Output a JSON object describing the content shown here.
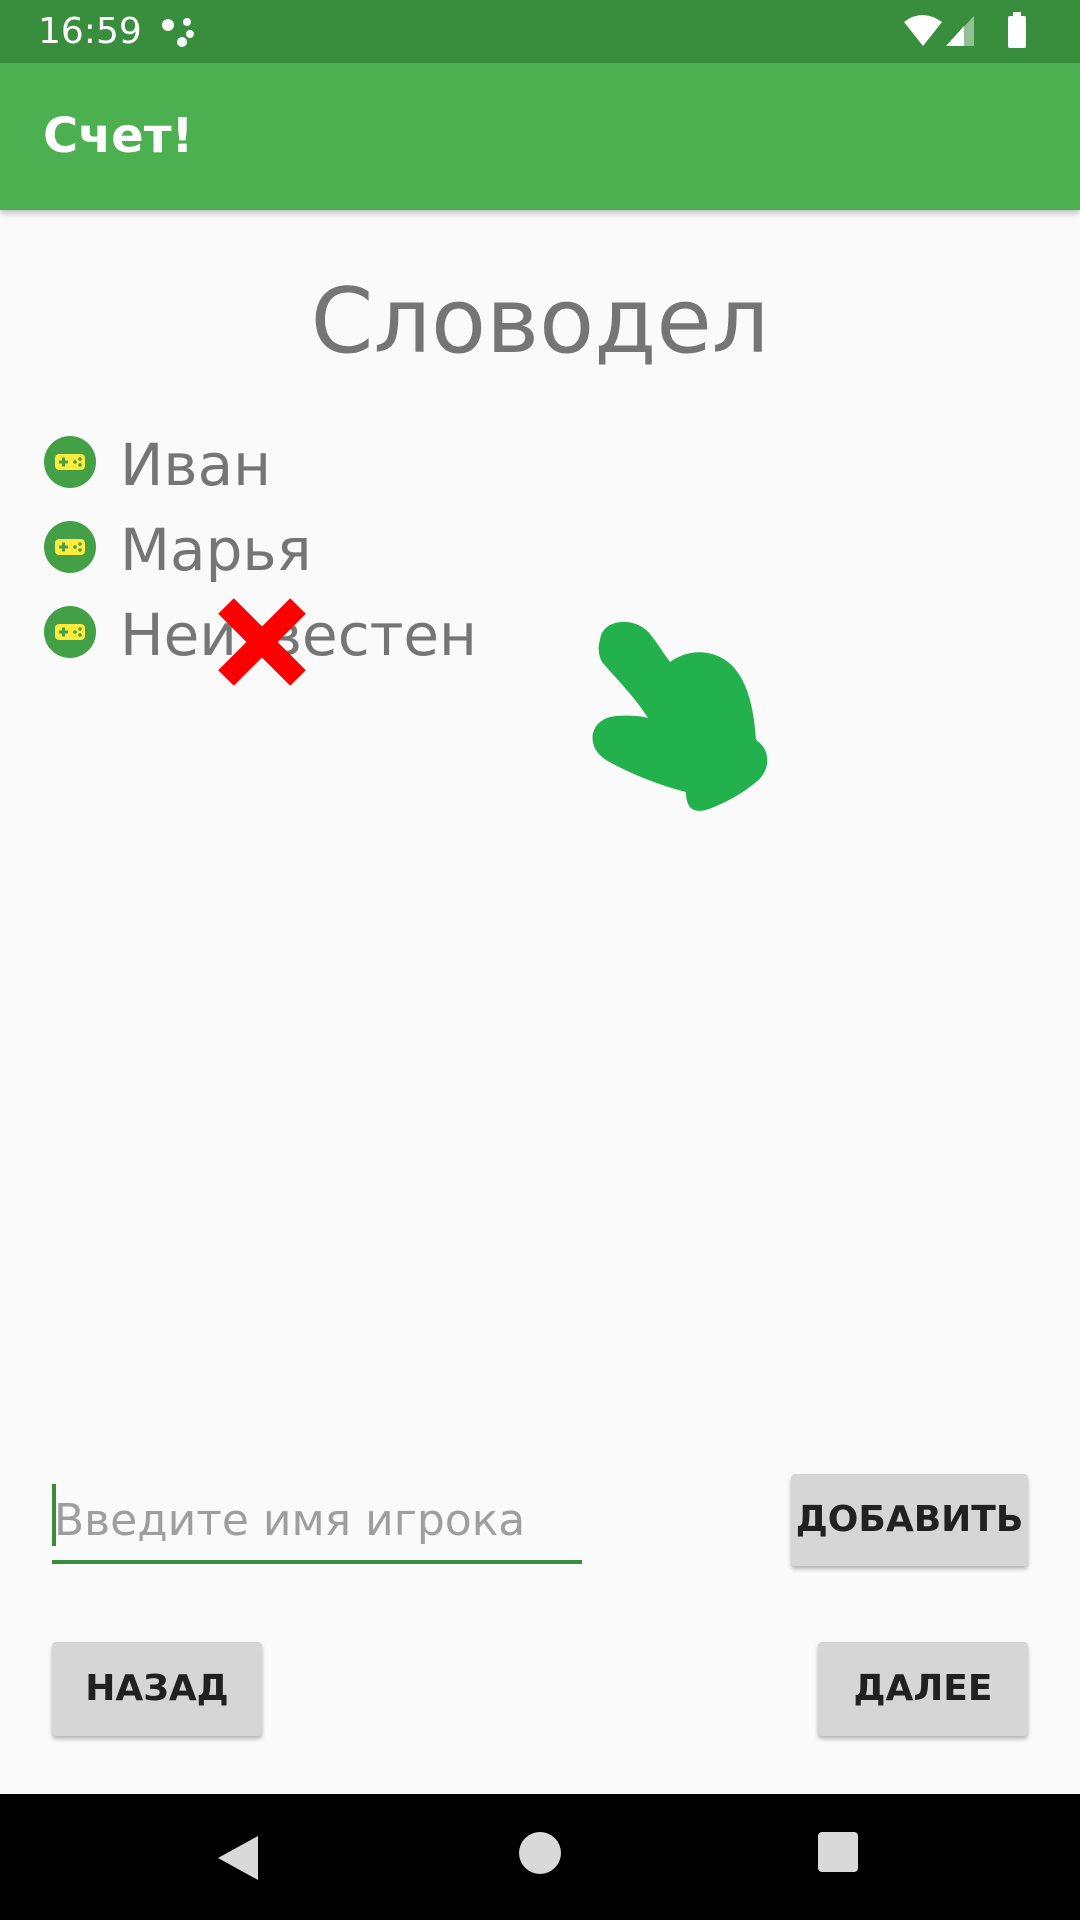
{
  "status_bar": {
    "time": "16:59",
    "icons": [
      "assistant-dots-icon",
      "wifi-icon",
      "signal-icon",
      "battery-icon"
    ]
  },
  "app_bar": {
    "title": "Счет!"
  },
  "game": {
    "title": "Словодел"
  },
  "players": [
    {
      "name": "Иван",
      "icon": "gamepad-icon"
    },
    {
      "name": "Марья",
      "icon": "gamepad-icon"
    },
    {
      "name": "Неизвестен",
      "icon": "gamepad-icon"
    }
  ],
  "overlay": {
    "delete_icon": "red-x-delete-icon",
    "gesture_icon": "swipe-hand-icon"
  },
  "input": {
    "placeholder": "Введите имя игрока",
    "value": ""
  },
  "buttons": {
    "add": "ДОБАВИТЬ",
    "back": "НАЗАД",
    "next": "ДАЛЕЕ"
  },
  "navigation": {
    "icons": [
      "back-icon",
      "home-icon",
      "recents-icon"
    ]
  },
  "colors": {
    "status_bar": "#388e3c",
    "app_bar": "#4caf50",
    "accent": "#388e3c",
    "icon_circle": "#43a047",
    "icon_pad": "#ffeb3b",
    "delete": "#ff0000",
    "gesture": "#22b14c"
  }
}
